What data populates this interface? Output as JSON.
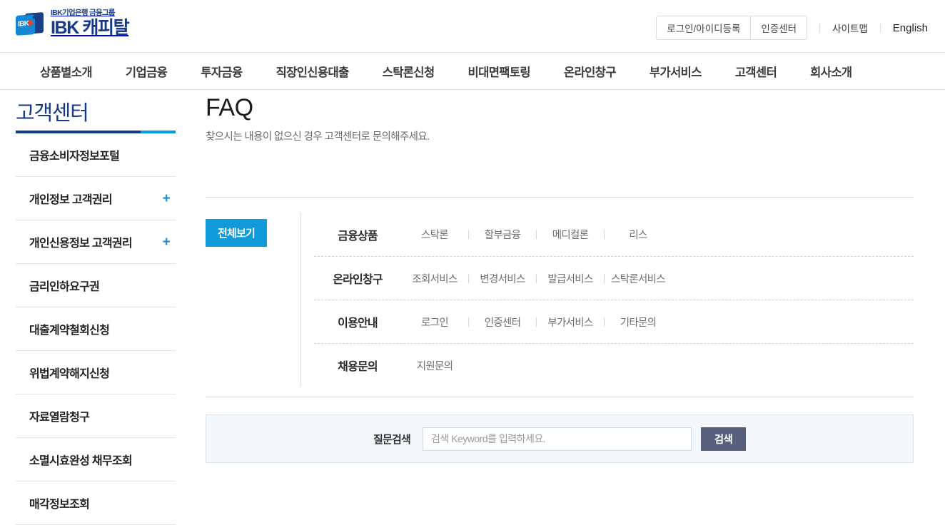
{
  "header": {
    "logo": {
      "superscript": "IBK기업은행 금융그룹",
      "wordmark": "IBK 캐피탈",
      "mark_text": "IBK"
    },
    "utility": {
      "boxed_links": [
        "로그인/아이디등록",
        "인증센터"
      ],
      "sitemap": "사이트맵",
      "english": "English"
    }
  },
  "gnb": {
    "items": [
      "상품별소개",
      "기업금융",
      "투자금융",
      "직장인신용대출",
      "스탁론신청",
      "비대면팩토링",
      "온라인창구",
      "부가서비스",
      "고객센터",
      "회사소개"
    ]
  },
  "sidebar": {
    "title": "고객센터",
    "items": [
      {
        "label": "금융소비자정보포털",
        "expandable": false
      },
      {
        "label": "개인정보 고객권리",
        "expandable": true,
        "expand_icon": "+"
      },
      {
        "label": "개인신용정보 고객권리",
        "expandable": true,
        "expand_icon": "+"
      },
      {
        "label": "금리인하요구권",
        "expandable": false
      },
      {
        "label": "대출계약철회신청",
        "expandable": false
      },
      {
        "label": "위법계약해지신청",
        "expandable": false
      },
      {
        "label": "자료열람청구",
        "expandable": false
      },
      {
        "label": "소멸시효완성 채무조회",
        "expandable": false
      },
      {
        "label": "매각정보조회",
        "expandable": false
      }
    ]
  },
  "main": {
    "title": "FAQ",
    "description": "찾으시는 내용이 없으신 경우 고객센터로 문의해주세요.",
    "filter": {
      "view_all_label": "전체보기",
      "rows": [
        {
          "label": "금융상품",
          "subs": [
            "스탁론",
            "할부금융",
            "메디컬론",
            "리스"
          ]
        },
        {
          "label": "온라인창구",
          "subs": [
            "조회서비스",
            "변경서비스",
            "발급서비스",
            "스탁론서비스"
          ]
        },
        {
          "label": "이용안내",
          "subs": [
            "로그인",
            "인증센터",
            "부가서비스",
            "기타문의"
          ]
        },
        {
          "label": "채용문의",
          "subs": [
            "지원문의"
          ]
        }
      ]
    },
    "search": {
      "label": "질문검색",
      "placeholder": "검색 Keyword를 입력하세요.",
      "value": "",
      "button_label": "검색"
    }
  },
  "colors": {
    "brand_navy": "#17398a",
    "brand_blue": "#119ad9",
    "accent_cyan": "#00a0e0",
    "search_button": "#585f7d",
    "panel_bg": "#f4f8fb"
  }
}
